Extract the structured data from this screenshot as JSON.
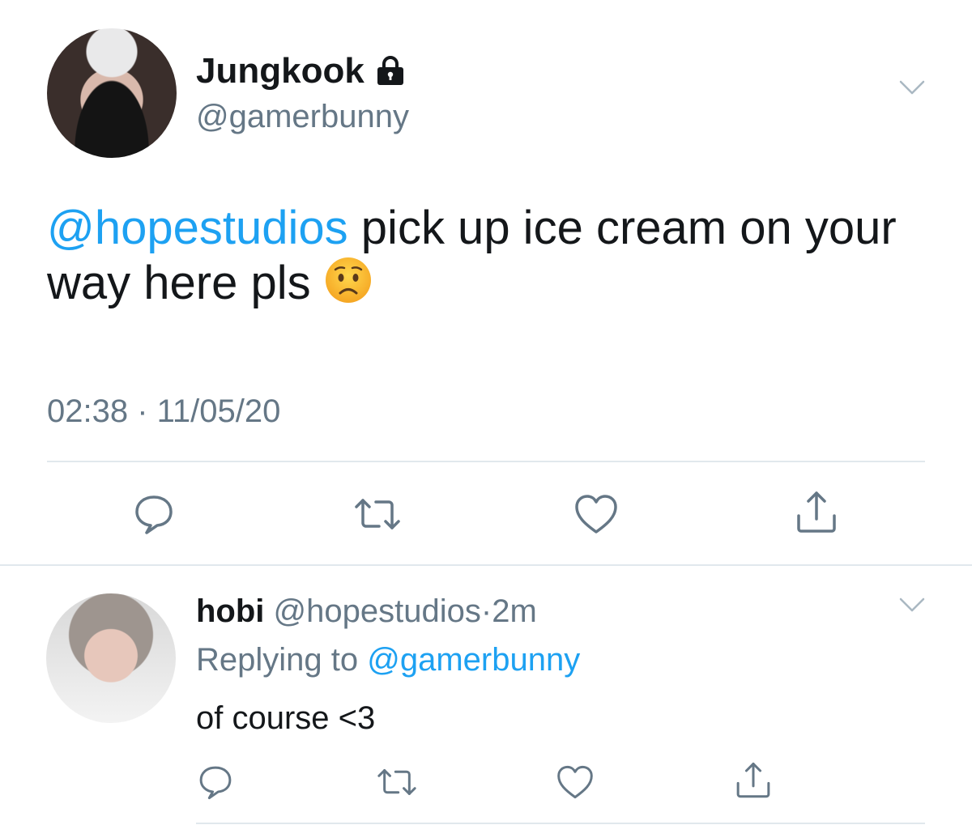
{
  "main_tweet": {
    "display_name": "Jungkook",
    "handle": "@gamerbunny",
    "mention": "@hopestudios",
    "text": " pick up ice cream on your way here pls ",
    "emoji": "😟",
    "timestamp": "02:38 · 11/05/20",
    "icons": {
      "lock": "lock-icon",
      "chevron": "chevron-down-icon",
      "reply": "reply-icon",
      "retweet": "retweet-icon",
      "like": "heart-icon",
      "share": "share-icon"
    }
  },
  "reply_tweet": {
    "display_name": "hobi",
    "handle": "@hopestudios",
    "separator": "·",
    "time": "2m",
    "replying_prefix": "Replying to ",
    "replying_to": "@gamerbunny",
    "text": "of course <3"
  },
  "colors": {
    "accent": "#1da1f2",
    "muted": "#657786",
    "text": "#14171a",
    "divider": "#e1e8ed"
  }
}
